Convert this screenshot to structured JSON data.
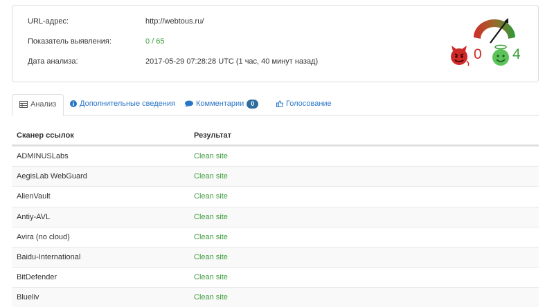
{
  "info": {
    "url_label": "URL-адрес:",
    "url_value": "http://webtous.ru/",
    "detection_label": "Показатель выявления:",
    "detection_value": "0 / 65",
    "date_label": "Дата анализа:",
    "date_value": "2017-05-29 07:28:28 UTC (1 час, 40 минут назад)"
  },
  "scores": {
    "malicious": "0",
    "harmless": "4",
    "malicious_icon": "devil-face-icon",
    "harmless_icon": "angel-face-icon",
    "gauge_icon": "gauge-icon"
  },
  "tabs": [
    {
      "label": "Анализ",
      "icon": "table-icon"
    },
    {
      "label": "Дополнительные сведения",
      "icon": "info-icon"
    },
    {
      "label": "Комментарии",
      "icon": "comment-icon",
      "badge": "0"
    },
    {
      "label": "Голосование",
      "icon": "thumbs-up-icon"
    }
  ],
  "table": {
    "headers": [
      "Сканер ссылок",
      "Результат"
    ],
    "rows": [
      [
        "ADMINUSLabs",
        "Clean site"
      ],
      [
        "AegisLab WebGuard",
        "Clean site"
      ],
      [
        "AlienVault",
        "Clean site"
      ],
      [
        "Antiy-AVL",
        "Clean site"
      ],
      [
        "Avira (no cloud)",
        "Clean site"
      ],
      [
        "Baidu-International",
        "Clean site"
      ],
      [
        "BitDefender",
        "Clean site"
      ],
      [
        "Blueliv",
        "Clean site"
      ]
    ]
  },
  "colors": {
    "link": "#2a76c6",
    "clean": "#3c9b3c",
    "malicious": "#cc2a27",
    "harmless": "#3aa03a",
    "badge": "#2c6d9e"
  }
}
